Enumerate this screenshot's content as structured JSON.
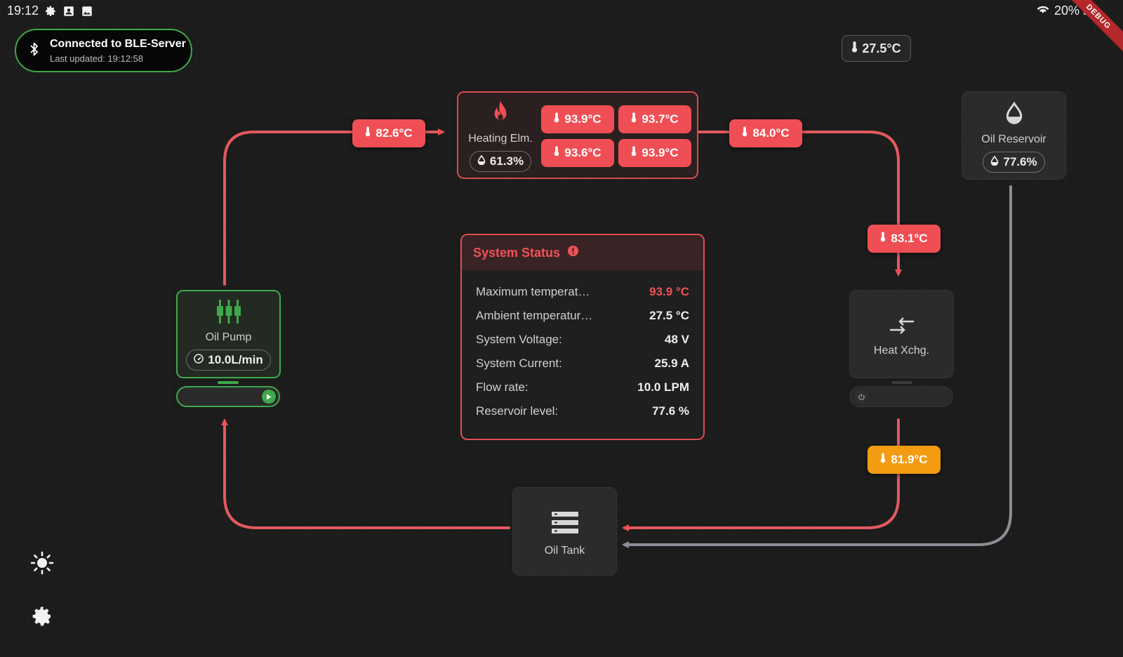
{
  "status_bar": {
    "time": "19:12",
    "battery": "20%"
  },
  "debug_banner": "DEBUG",
  "connection": {
    "title": "Connected to BLE-Server",
    "subtitle": "Last updated: 19:12:58"
  },
  "ambient_chip": "27.5°C",
  "pipe_temps": {
    "pump_to_heater": "82.6°C",
    "heater_out": "84.0°C",
    "xchg_in": "83.1°C",
    "xchg_out": "81.9°C"
  },
  "heating_element": {
    "label": "Heating Elm.",
    "power": "61.3%",
    "sensors": [
      "93.9°C",
      "93.7°C",
      "93.6°C",
      "93.9°C"
    ]
  },
  "oil_pump": {
    "label": "Oil Pump",
    "flow": "10.0L/min",
    "running": true
  },
  "heat_exchanger": {
    "label": "Heat Xchg.",
    "running": false
  },
  "oil_reservoir": {
    "label": "Oil Reservoir",
    "level": "77.6%"
  },
  "oil_tank": {
    "label": "Oil Tank"
  },
  "system_status": {
    "title": "System Status",
    "rows": [
      {
        "key": "Maximum temperat…",
        "value": "93.9 °C"
      },
      {
        "key": "Ambient temperatur…",
        "value": "27.5 °C"
      },
      {
        "key": "System Voltage:",
        "value": "48 V"
      },
      {
        "key": "System Current:",
        "value": "25.9 A"
      },
      {
        "key": "Flow rate:",
        "value": "10.0 LPM"
      },
      {
        "key": "Reservoir level:",
        "value": "77.6 %"
      }
    ]
  },
  "icons": [
    "bluetooth-icon",
    "thermometer-icon",
    "flame-icon",
    "droplet-icon",
    "pump-icon",
    "gauge-icon",
    "play-icon",
    "exchange-icon",
    "power-icon",
    "tank-icon",
    "sun-icon",
    "gear-icon",
    "wifi-icon",
    "alert-icon"
  ],
  "colors": {
    "hot": "#ef4f54",
    "warm": "#f39c12",
    "ok": "#3fa84a",
    "idle": "#8a8f96"
  }
}
